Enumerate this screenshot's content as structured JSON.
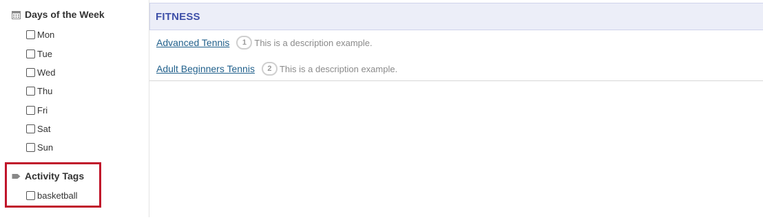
{
  "filters": {
    "days": {
      "title": "Days of the Week",
      "icon": "calendar-icon",
      "items": [
        "Mon",
        "Tue",
        "Wed",
        "Thu",
        "Fri",
        "Sat",
        "Sun"
      ]
    },
    "tags": {
      "title": "Activity Tags",
      "icon": "tag-icon",
      "items": [
        "basketball"
      ]
    }
  },
  "highlight_color": "#c0142a",
  "category": {
    "title": "FITNESS",
    "activities": [
      {
        "name": "Advanced Tennis",
        "count": "1",
        "description": "This is a description example."
      },
      {
        "name": "Adult Beginners Tennis",
        "count": "2",
        "description": "This is a description example."
      }
    ]
  }
}
